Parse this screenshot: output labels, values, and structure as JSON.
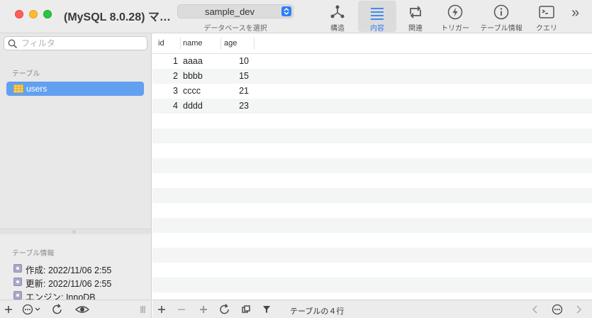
{
  "window": {
    "title": "(MySQL 8.0.28) マ…"
  },
  "db_selector": {
    "value": "sample_dev",
    "caption": "データベースを選択"
  },
  "toolbar": {
    "structure": "構造",
    "content": "内容",
    "relations": "関連",
    "triggers": "トリガー",
    "table_info": "テーブル情報",
    "query": "クエリ",
    "more": "»"
  },
  "sidebar": {
    "search_placeholder": "フィルタ",
    "tables_heading": "テーブル",
    "tables": [
      {
        "name": "users",
        "selected": true
      }
    ],
    "info_heading": "テーブル情報",
    "info": [
      "作成: 2022/11/06 2:55",
      "更新: 2022/11/06 2:55",
      "エンジン: InnoDB"
    ]
  },
  "grid": {
    "columns": [
      "id",
      "name",
      "age"
    ],
    "rows": [
      {
        "id": "1",
        "name": "aaaa",
        "age": "10"
      },
      {
        "id": "2",
        "name": "bbbb",
        "age": "15"
      },
      {
        "id": "3",
        "name": "cccc",
        "age": "21"
      },
      {
        "id": "4",
        "name": "dddd",
        "age": "23"
      }
    ]
  },
  "status": {
    "row_count": "テーブルの４行"
  },
  "colors": {
    "accent": "#2f7ef6",
    "selection": "#62a0f0",
    "stripe": "#f4f5f5"
  }
}
